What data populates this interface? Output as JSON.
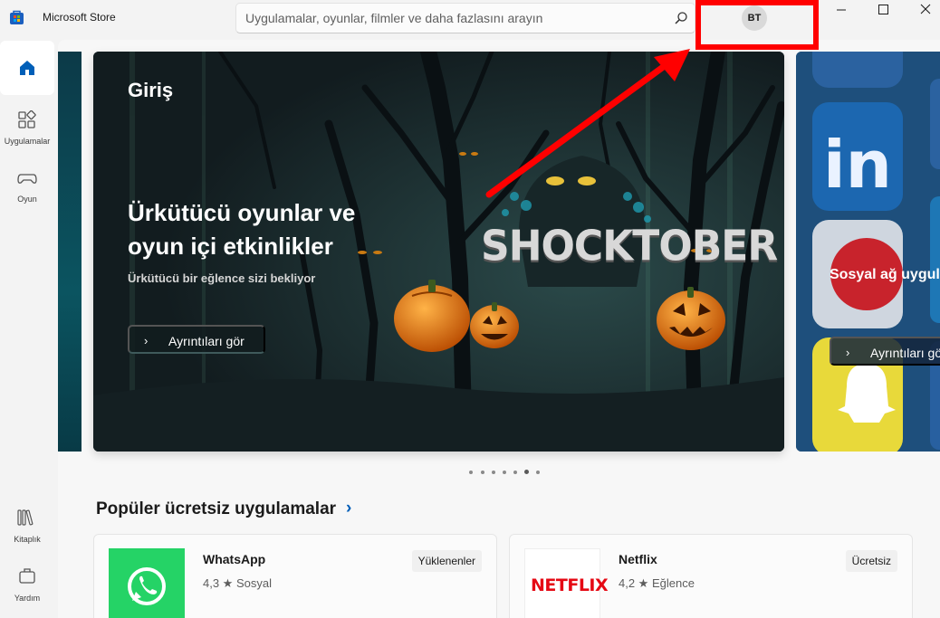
{
  "window": {
    "title": "Microsoft Store",
    "profile_initials": "BT"
  },
  "search": {
    "placeholder": "Uygulamalar, oyunlar, filmler ve daha fazlasını arayın"
  },
  "sidebar": {
    "items": [
      {
        "label": ""
      },
      {
        "label": "Uygulamalar"
      },
      {
        "label": "Oyun"
      },
      {
        "label": "Kitaplık"
      },
      {
        "label": "Yardım"
      }
    ]
  },
  "hero": {
    "heading": "Giriş",
    "title": "Ürkütücü oyunlar ve oyun içi etkinlikler",
    "subtitle": "Ürkütücü bir eğlence sizi bekliyor",
    "button_label": "Ayrıntıları gör",
    "artwork_text": "SHOCKTOBER"
  },
  "next_card": {
    "title": "Sosyal ağ uygul",
    "button_label": "Ayrıntıları gör"
  },
  "section": {
    "title": "Popüler ücretsiz uygulamalar",
    "chevron": "›"
  },
  "apps": [
    {
      "name": "WhatsApp",
      "rating": "4,3 ★",
      "category": "Sosyal",
      "badge": "Yüklenenler"
    },
    {
      "name": "Netflix",
      "rating": "4,2 ★",
      "category": "Eğlence",
      "badge": "Ücretsiz"
    }
  ],
  "icons": {
    "netflix_logo": "NETFLIX"
  },
  "colors": {
    "accent": "#005fb8",
    "annotation_red": "#ff0000",
    "whatsapp_green": "#25d366",
    "netflix_red": "#e50914"
  }
}
